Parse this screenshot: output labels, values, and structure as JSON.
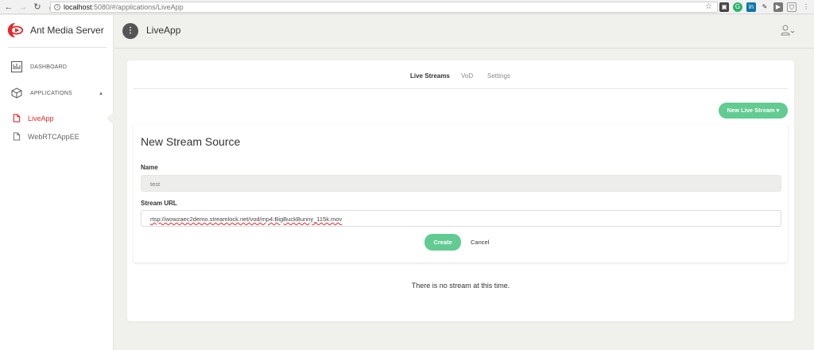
{
  "browser": {
    "url_host": "localhost",
    "url_path": ":5080/#/applications/LiveApp"
  },
  "sidebar": {
    "brand": "Ant Media Server",
    "items": [
      {
        "label": "DASHBOARD",
        "icon": "dashboard-icon"
      },
      {
        "label": "APPLICATIONS",
        "icon": "box-icon"
      }
    ],
    "apps": [
      {
        "label": "LiveApp",
        "active": true
      },
      {
        "label": "WebRTCAppEE",
        "active": false
      }
    ]
  },
  "topbar": {
    "badge": "⋮",
    "title": "LiveApp"
  },
  "tabs": [
    "Live Streams",
    "VoD",
    "Settings"
  ],
  "new_stream_button": "New Live Stream ▾",
  "form": {
    "title": "New Stream Source",
    "name_label": "Name",
    "name_value": "test",
    "url_label": "Stream URL",
    "url_value": "rtsp://wowzaec2demo.streamlock.net/vod/mp4:BigBuckBunny_115k.mov",
    "create_label": "Create",
    "cancel_label": "Cancel"
  },
  "empty_message": "There is no stream at this time.",
  "colors": {
    "accent_green": "#62cb92",
    "active_red": "#e22b2b"
  }
}
